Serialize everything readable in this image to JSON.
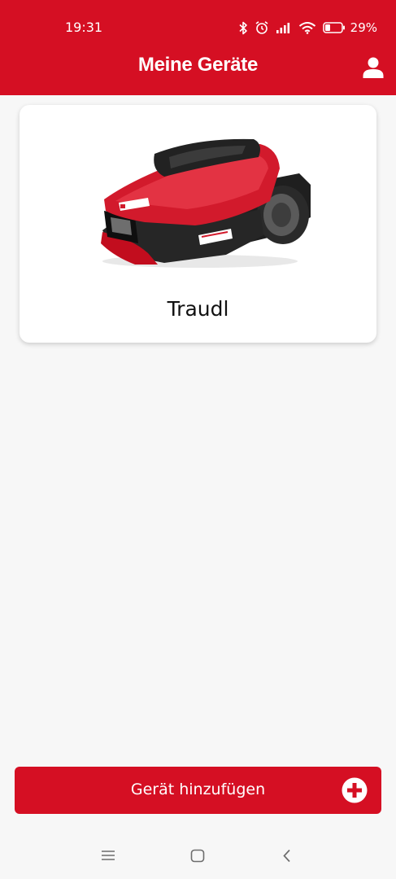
{
  "status_bar": {
    "time": "19:31",
    "battery": "29%",
    "icons": [
      "bluetooth-icon",
      "alarm-icon",
      "signal-icon",
      "wifi-icon",
      "battery-icon"
    ]
  },
  "header": {
    "title": "Meine Geräte",
    "profile_icon": "person-icon"
  },
  "devices": [
    {
      "name": "Traudl",
      "image": "robot-lawnmower"
    }
  ],
  "add_device": {
    "label": "Gerät hinzufügen",
    "icon": "plus-circle-icon"
  },
  "nav_bar": {
    "buttons": [
      "menu-icon",
      "home-icon",
      "back-icon"
    ]
  },
  "colors": {
    "primary": "#d50f23",
    "background": "#f7f7f7",
    "card": "#ffffff"
  }
}
